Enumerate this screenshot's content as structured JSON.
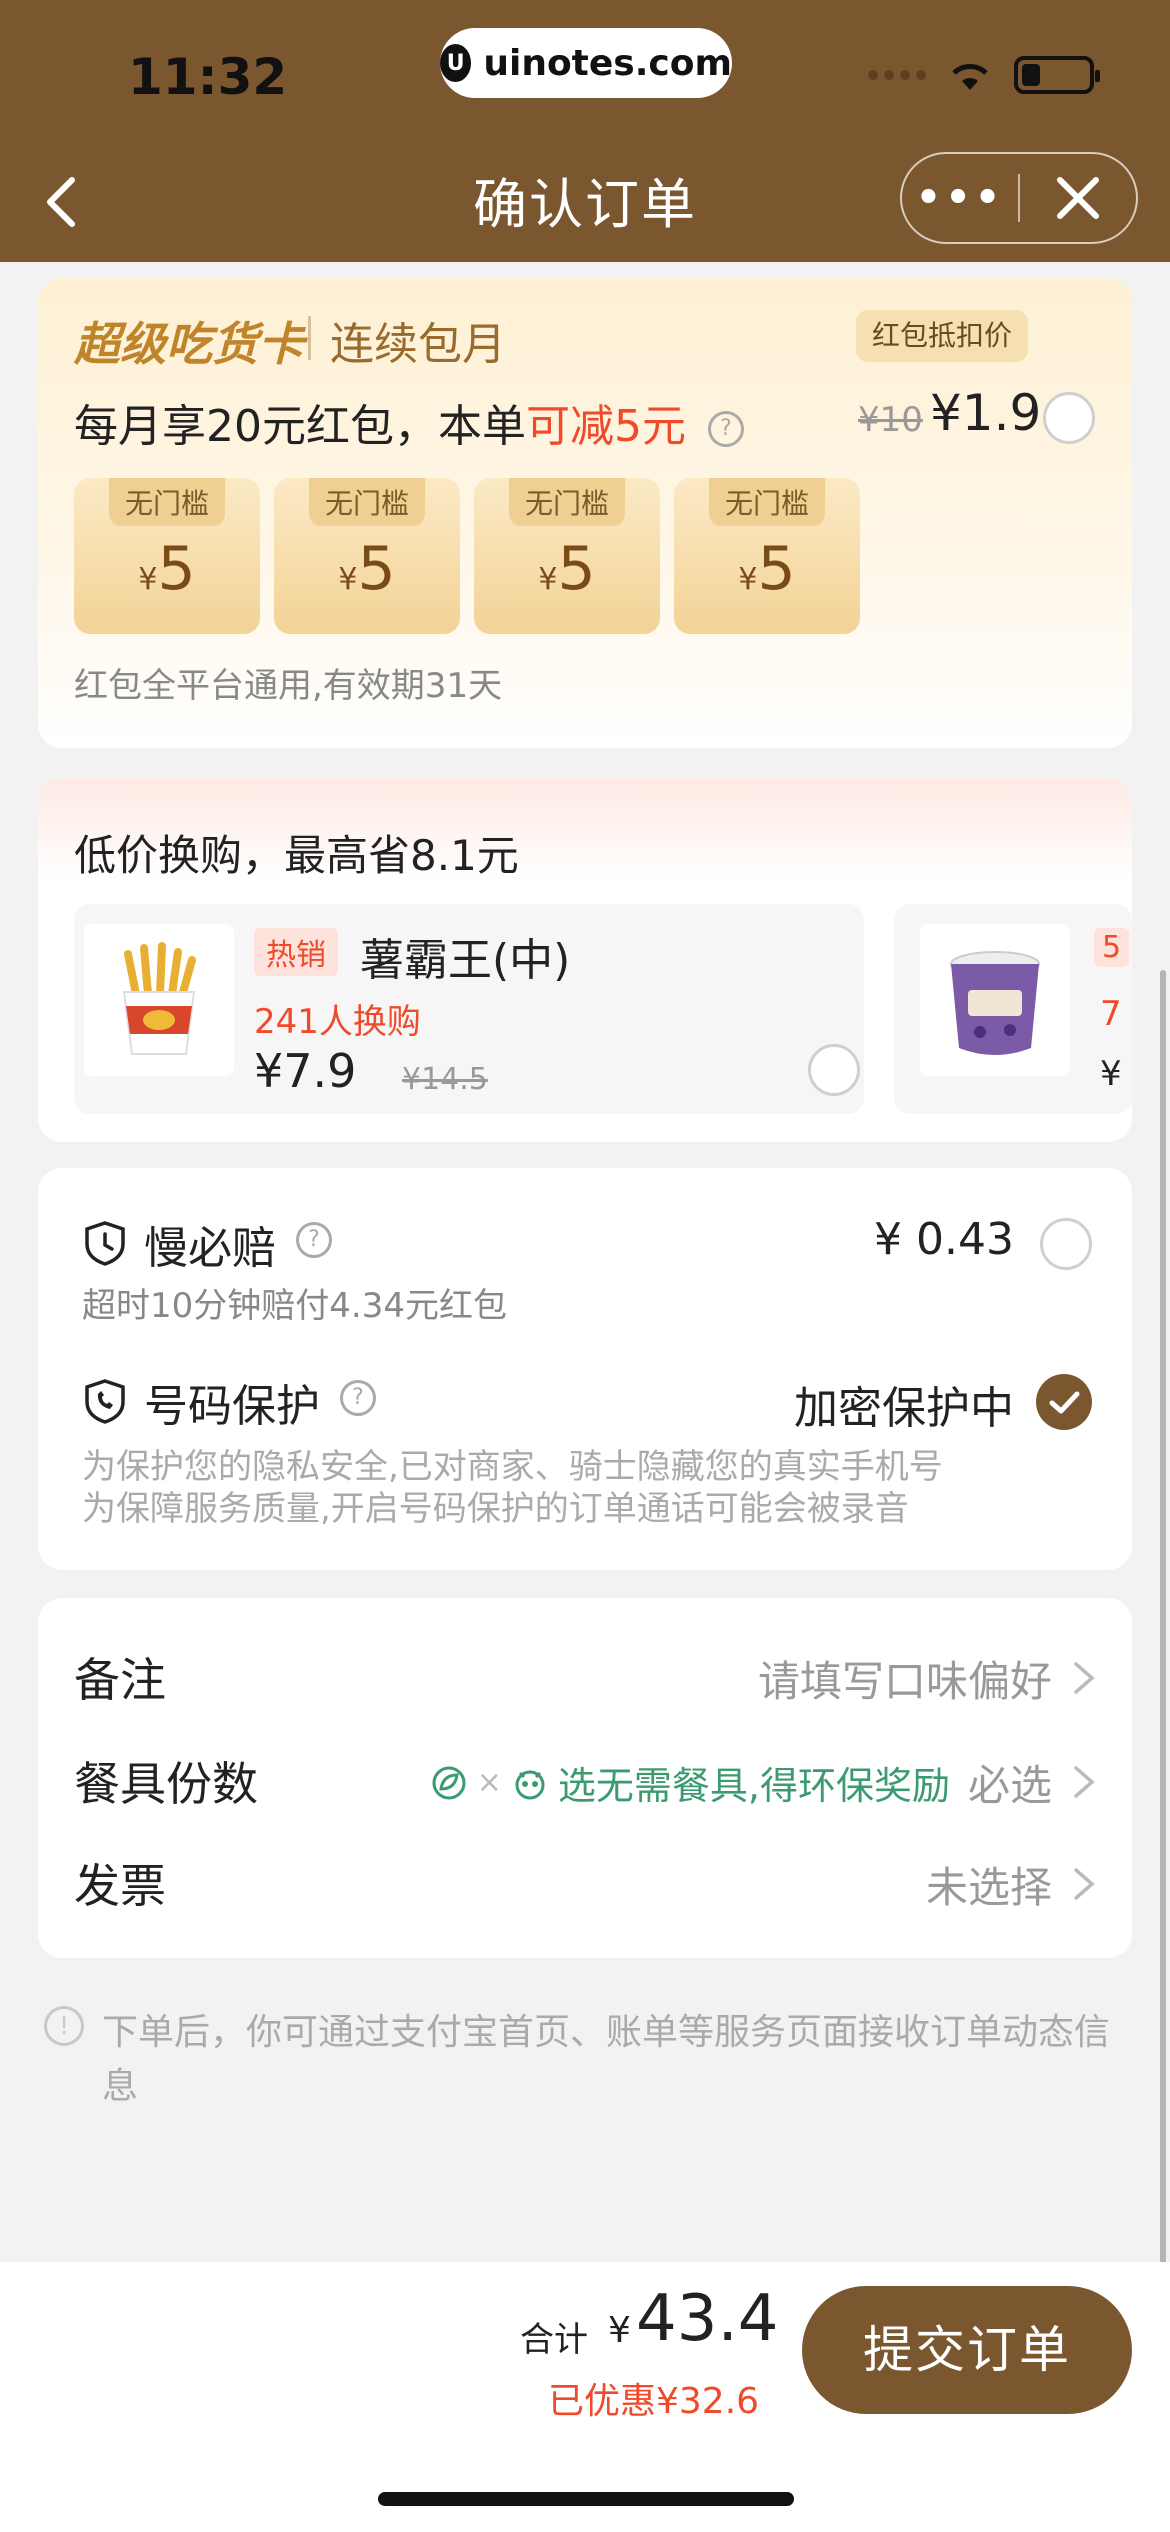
{
  "status_bar": {
    "time": "11:32",
    "url": "uinotes.com"
  },
  "nav": {
    "title": "确认订单",
    "more": "•••"
  },
  "member_card": {
    "title": "超级吃货卡",
    "subtitle": "连续包月",
    "offer_prefix": "每月享20元红包，本单",
    "offer_highlight": "可减5元",
    "help": "?",
    "badge": "红包抵扣价",
    "old_price": "¥10",
    "new_price": "¥1.9",
    "coupons": [
      {
        "tag": "无门槛",
        "currency": "¥",
        "amount": "5"
      },
      {
        "tag": "无门槛",
        "currency": "¥",
        "amount": "5"
      },
      {
        "tag": "无门槛",
        "currency": "¥",
        "amount": "5"
      },
      {
        "tag": "无门槛",
        "currency": "¥",
        "amount": "5"
      }
    ],
    "note": "红包全平台通用,有效期31天"
  },
  "swap": {
    "title": "低价换购，最高省8.1元",
    "products": [
      {
        "tag": "热销",
        "name": "薯霸王(中)",
        "sold": "241人换购",
        "price": "¥7.9",
        "old_price": "¥14.5"
      },
      {
        "tag": "5",
        "sold": "7",
        "price": "¥"
      }
    ]
  },
  "services": {
    "late": {
      "title": "慢必赔",
      "help": "?",
      "price": "¥ 0.43",
      "sub": "超时10分钟赔付4.34元红包"
    },
    "privacy": {
      "title": "号码保护",
      "help": "?",
      "status": "加密保护中",
      "line1": "为保护您的隐私安全,已对商家、骑士隐藏您的真实手机号",
      "line2": "为保障服务质量,开启号码保护的订单通话可能会被录音"
    }
  },
  "options": {
    "remark": {
      "label": "备注",
      "value": "请填写口味偏好"
    },
    "utensils": {
      "label": "餐具份数",
      "eco_sep": "×",
      "eco_text": "选无需餐具,得环保奖励",
      "value": "必选"
    },
    "invoice": {
      "label": "发票",
      "value": "未选择"
    }
  },
  "tip": {
    "icon": "!",
    "text": "下单后，你可通过支付宝首页、账单等服务页面接收订单动态信息"
  },
  "footer": {
    "total_label": "合计",
    "currency": "¥",
    "total": "43.4",
    "discount": "已优惠¥32.6",
    "submit": "提交订单"
  },
  "colors": {
    "brand": "#7b5730",
    "accent_red": "#f04a2a",
    "eco_green": "#3b9a6f"
  }
}
